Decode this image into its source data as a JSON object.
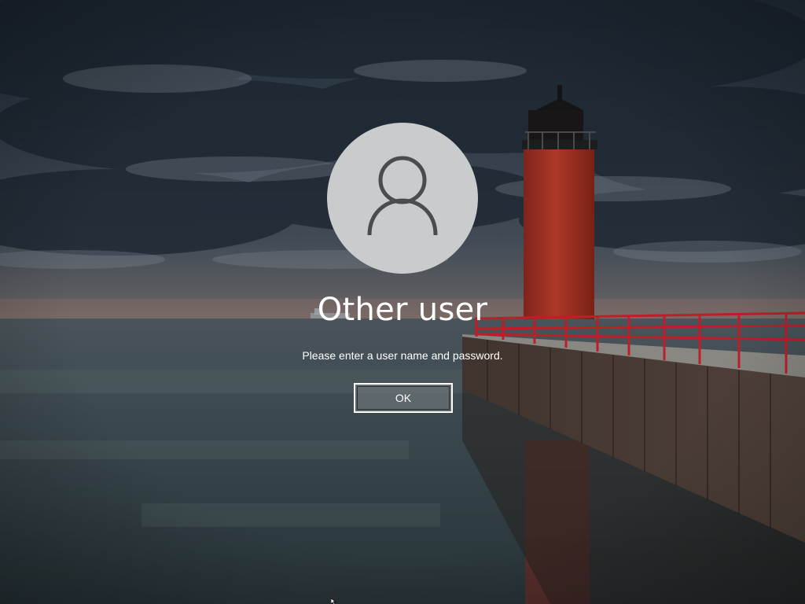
{
  "lock_screen": {
    "username": "Other user",
    "message": "Please enter a user name and password.",
    "ok_label": "OK",
    "avatar_icon": "user-silhouette-icon",
    "colors": {
      "avatar_bg": "#c9cbcd",
      "avatar_icon": "#4a4d50",
      "lighthouse": "#c23a2a",
      "railing": "#d8232e",
      "text": "#ffffff"
    }
  }
}
